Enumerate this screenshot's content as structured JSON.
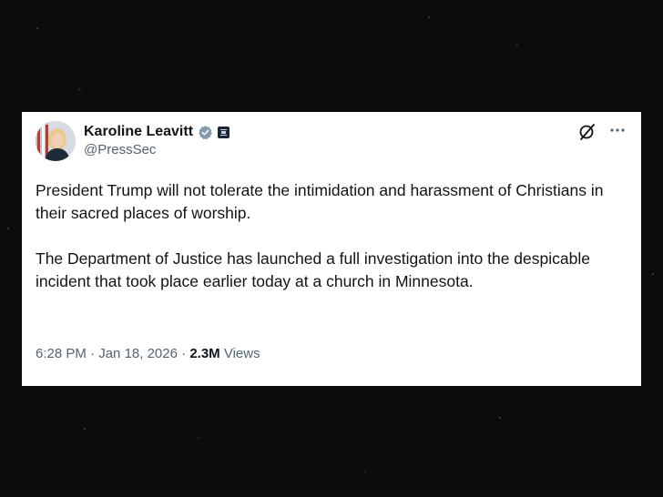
{
  "tweet": {
    "author": {
      "display_name": "Karoline Leavitt",
      "handle": "@PressSec",
      "verified_badge_color": "#829aab",
      "affiliate_badge_icon": "white-house-seal-icon"
    },
    "paragraphs": [
      "President Trump will not tolerate the intimidation and harassment of Christians in their sacred places of worship.",
      "The Department of Justice has launched a full investigation into the despicable incident that took place earlier today at a church in Minnesota."
    ],
    "time": "6:28 PM",
    "separator": "·",
    "date": "Jan 18, 2026",
    "views_count": "2.3M",
    "views_label": "Views"
  },
  "colors": {
    "card_background": "#ffffff",
    "text_primary": "#0f1419",
    "text_secondary": "#536471",
    "page_background": "#0c0c0c"
  },
  "icons": {
    "top_right_1": "grok-slash-icon",
    "top_right_2": "more-options-icon"
  }
}
